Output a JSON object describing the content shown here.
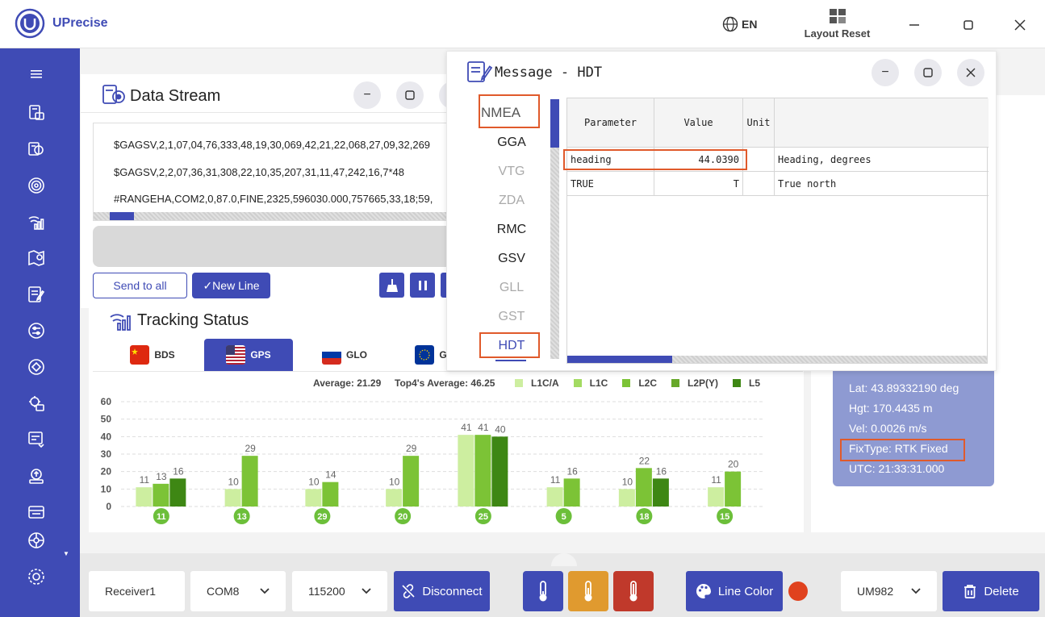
{
  "app": {
    "name": "UPrecise",
    "language": "EN",
    "layout_reset": "Layout Reset"
  },
  "sidebar": {
    "items": [
      "menu-icon",
      "receiver-icon",
      "data-stream-icon",
      "radar-icon",
      "signal-tracking-icon",
      "map-icon",
      "message-icon",
      "settings-list-icon",
      "satellite-icon",
      "config-icon",
      "log-icon",
      "upgrade-icon",
      "device-icon",
      "network-icon",
      "gear-icon"
    ]
  },
  "data_stream": {
    "title": "Data Stream",
    "lines": [
      "$GAGSV,2,1,07,04,76,333,48,19,30,069,42,21,22,068,27,09,32,269",
      "$GAGSV,2,2,07,36,31,308,22,10,35,207,31,11,47,242,16,7*48",
      "#RANGEHA,COM2,0,87.0,FINE,2325,596030.000,757665,33,18;59,"
    ],
    "send_all": "Send to all",
    "new_line": "✓New Line"
  },
  "tracking": {
    "title": "Tracking Status",
    "tabs": [
      {
        "label": "BDS",
        "flag": "china"
      },
      {
        "label": "GPS",
        "flag": "usa",
        "active": true
      },
      {
        "label": "GLO",
        "flag": "russia"
      },
      {
        "label": "G",
        "flag": "eu"
      }
    ],
    "average": "Average: 21.29",
    "top4": "Top4's Average: 46.25"
  },
  "chart_data": {
    "type": "bar",
    "categories": [
      "11",
      "13",
      "29",
      "20",
      "25",
      "5",
      "18",
      "15"
    ],
    "series": [
      {
        "name": "L1C/A",
        "color": "#cdeea0",
        "values": [
          11,
          10,
          10,
          10,
          41,
          11,
          10,
          11
        ]
      },
      {
        "name": "L1C",
        "color": "#a3db62",
        "values": [
          null,
          null,
          null,
          null,
          null,
          null,
          null,
          null
        ]
      },
      {
        "name": "L2C",
        "color": "#7cc336",
        "values": [
          13,
          29,
          14,
          29,
          41,
          16,
          22,
          20
        ]
      },
      {
        "name": "L2P(Y)",
        "color": "#67a82a",
        "values": [
          null,
          null,
          null,
          null,
          null,
          null,
          null,
          null
        ]
      },
      {
        "name": "L5",
        "color": "#3e8714",
        "values": [
          16,
          null,
          null,
          null,
          40,
          null,
          16,
          null
        ]
      }
    ],
    "yticks": [
      0,
      10,
      20,
      30,
      40,
      50,
      60
    ],
    "ylim": [
      0,
      60
    ]
  },
  "message": {
    "title": "Message - HDT",
    "nmea_header": "NMEA",
    "items": [
      {
        "label": "GGA",
        "state": "dark"
      },
      {
        "label": "VTG",
        "state": "light"
      },
      {
        "label": "ZDA",
        "state": "light"
      },
      {
        "label": "RMC",
        "state": "dark"
      },
      {
        "label": "GSV",
        "state": "dark"
      },
      {
        "label": "GLL",
        "state": "light"
      },
      {
        "label": "GST",
        "state": "light"
      },
      {
        "label": "HDT",
        "state": "selected"
      }
    ],
    "columns": [
      "Parameter",
      "Value",
      "Unit",
      ""
    ],
    "rows": [
      [
        "heading",
        "44.0390",
        "",
        "Heading, degrees"
      ],
      [
        "TRUE",
        "T",
        "",
        "True north"
      ]
    ]
  },
  "position": {
    "lat": "Lat: 43.89332190 deg",
    "hgt": "Hgt: 170.4435 m",
    "vel": "Vel: 0.0026 m/s",
    "fix": "FixType: RTK Fixed",
    "utc": "UTC: 21:33:31.000"
  },
  "bottom": {
    "receiver": "Receiver1",
    "port": "COM8",
    "baud": "115200",
    "disconnect": "Disconnect",
    "line_color": "Line Color",
    "model": "UM982",
    "delete": "Delete",
    "colors": {
      "accent": "#3f4bb5",
      "temp_orange": "#e09a2f",
      "temp_red": "#c0392b",
      "record": "#e0421e"
    }
  }
}
